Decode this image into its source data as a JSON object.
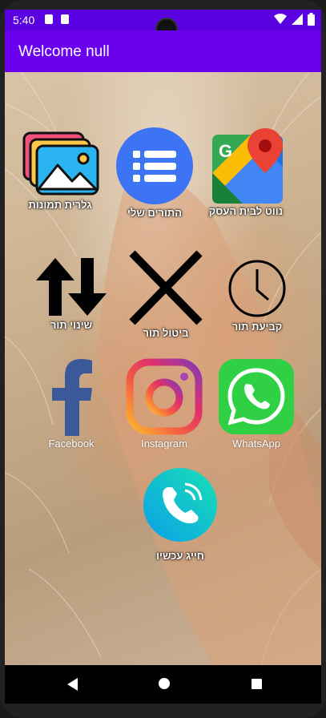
{
  "status_bar": {
    "time": "5:40"
  },
  "app_bar": {
    "title": "Welcome null"
  },
  "grid": {
    "gallery": {
      "label": "גלרית תמונות",
      "icon": "image-gallery-icon"
    },
    "my_appointments": {
      "label": "התורים שלי",
      "icon": "list-icon"
    },
    "navigate": {
      "label": "נווט לבית העסק",
      "icon": "google-maps-icon"
    },
    "change": {
      "label": "שינוי תור",
      "icon": "swap-vertical-icon"
    },
    "cancel": {
      "label": "ביטול תור",
      "icon": "close-icon"
    },
    "book": {
      "label": "קביעת תור",
      "icon": "clock-icon"
    },
    "facebook": {
      "label": "Facebook",
      "icon": "facebook-icon"
    },
    "instagram": {
      "label": "Instagram",
      "icon": "instagram-icon"
    },
    "whatsapp": {
      "label": "WhatsApp",
      "icon": "whatsapp-icon"
    },
    "call": {
      "label": "חייג עכשיו",
      "icon": "phone-call-icon"
    }
  },
  "colors": {
    "status_bar": "#5a00e0",
    "app_bar": "#6a00ee",
    "whatsapp": "#2fd044",
    "facebook": "#3b5998",
    "list_blue": "#3d74f5"
  }
}
